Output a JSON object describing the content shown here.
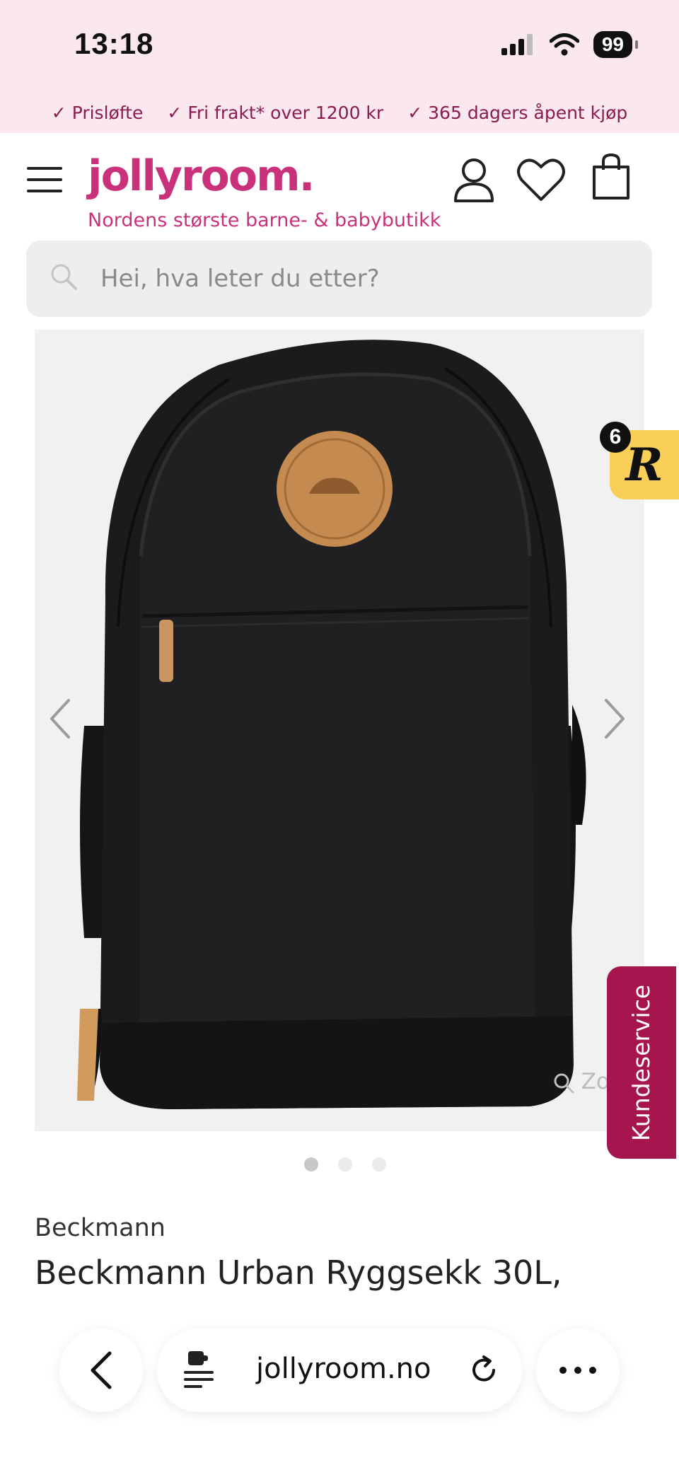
{
  "status_bar": {
    "time": "13:18",
    "battery": "99"
  },
  "promo": {
    "items": [
      {
        "icon": "check-icon",
        "label": "Prisløfte"
      },
      {
        "icon": "check-icon",
        "label": "Fri frakt* over 1200 kr"
      },
      {
        "icon": "check-icon",
        "label": "365 dagers åpent kjøp"
      }
    ]
  },
  "header": {
    "logo": "jollyroom.",
    "tagline": "Nordens største barne- & babybutikk",
    "icons": [
      "menu-icon",
      "account-icon",
      "wishlist-icon",
      "cart-icon"
    ]
  },
  "search": {
    "placeholder": "Hei, hva leter du etter?"
  },
  "gallery": {
    "zoom_label": "Zoom",
    "image_count": 3,
    "active_index": 0
  },
  "widgets": {
    "reward_count": "6",
    "reward_letter": "R",
    "customer_service": "Kundeservice"
  },
  "product": {
    "brand": "Beckmann",
    "title": "Beckmann Urban Ryggsekk 30L,"
  },
  "browser": {
    "url": "jollyroom.no"
  },
  "colors": {
    "brand_pink": "#c9327a",
    "promo_text": "#8a1b4f",
    "service_tab": "#a7154f",
    "reward_yellow": "#f9cf58",
    "promo_bg": "#fbe7ee"
  }
}
